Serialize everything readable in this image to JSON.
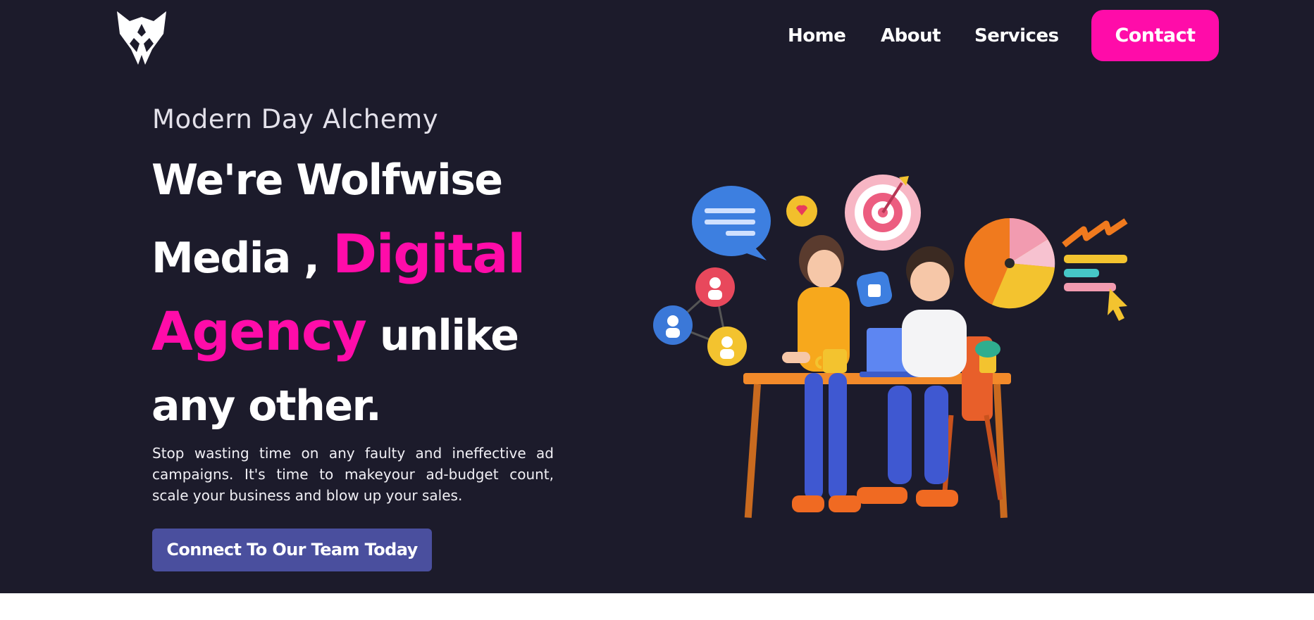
{
  "brand": {
    "logo_icon": "wolf-head-logo"
  },
  "nav": {
    "items": [
      {
        "label": "Home"
      },
      {
        "label": "About"
      },
      {
        "label": "Services"
      }
    ],
    "contact_label": "Contact"
  },
  "hero": {
    "tagline": "Modern Day Alchemy",
    "headline": {
      "line1": "We're Wolfwise",
      "line2_a": "Media , ",
      "line2_b": "Digital",
      "line3_a": "Agency",
      "line3_b": " unlike",
      "line4": "any other."
    },
    "description": "Stop wasting time on any faulty and ineffective ad campaigns. It's time to makeyour ad-budget count, scale your business and blow up your sales.",
    "cta_label": "Connect To Our Team Today",
    "illustration_icon": "team-at-desk-illustration"
  },
  "colors": {
    "background": "#1c1b2b",
    "accent_pink": "#ff0ca9",
    "cta_blue": "#4a4f9e",
    "text": "#ffffff"
  }
}
